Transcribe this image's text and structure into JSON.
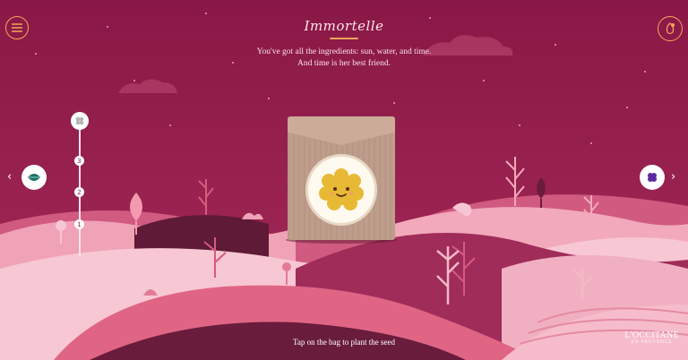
{
  "header": {
    "title": "Immortelle",
    "subtitle_line1": "You've got all the ingredients: sun, water, and time.",
    "subtitle_line2": "And time is her best friend."
  },
  "menu": {
    "icon": "hamburger-icon"
  },
  "seed_button": {
    "icon": "seed-icon"
  },
  "timeline": {
    "steps": [
      "3",
      "2",
      "1"
    ],
    "top_icon": "flower-icon"
  },
  "navigation": {
    "prev_icon": "leaf-icon",
    "next_icon": "berry-icon"
  },
  "bag": {
    "label_icon": "smiling-flower-icon"
  },
  "footer": {
    "cta": "Tap on the bag to plant the seed",
    "brand_name": "L'OCCITANE",
    "brand_sub": "EN PROVENCE"
  },
  "colors": {
    "sky": "#8e1b48",
    "accent": "#f2a65a",
    "hill_light": "#f4b8c6",
    "hill_mid": "#e8758f",
    "hill_dark": "#9c2a55"
  }
}
